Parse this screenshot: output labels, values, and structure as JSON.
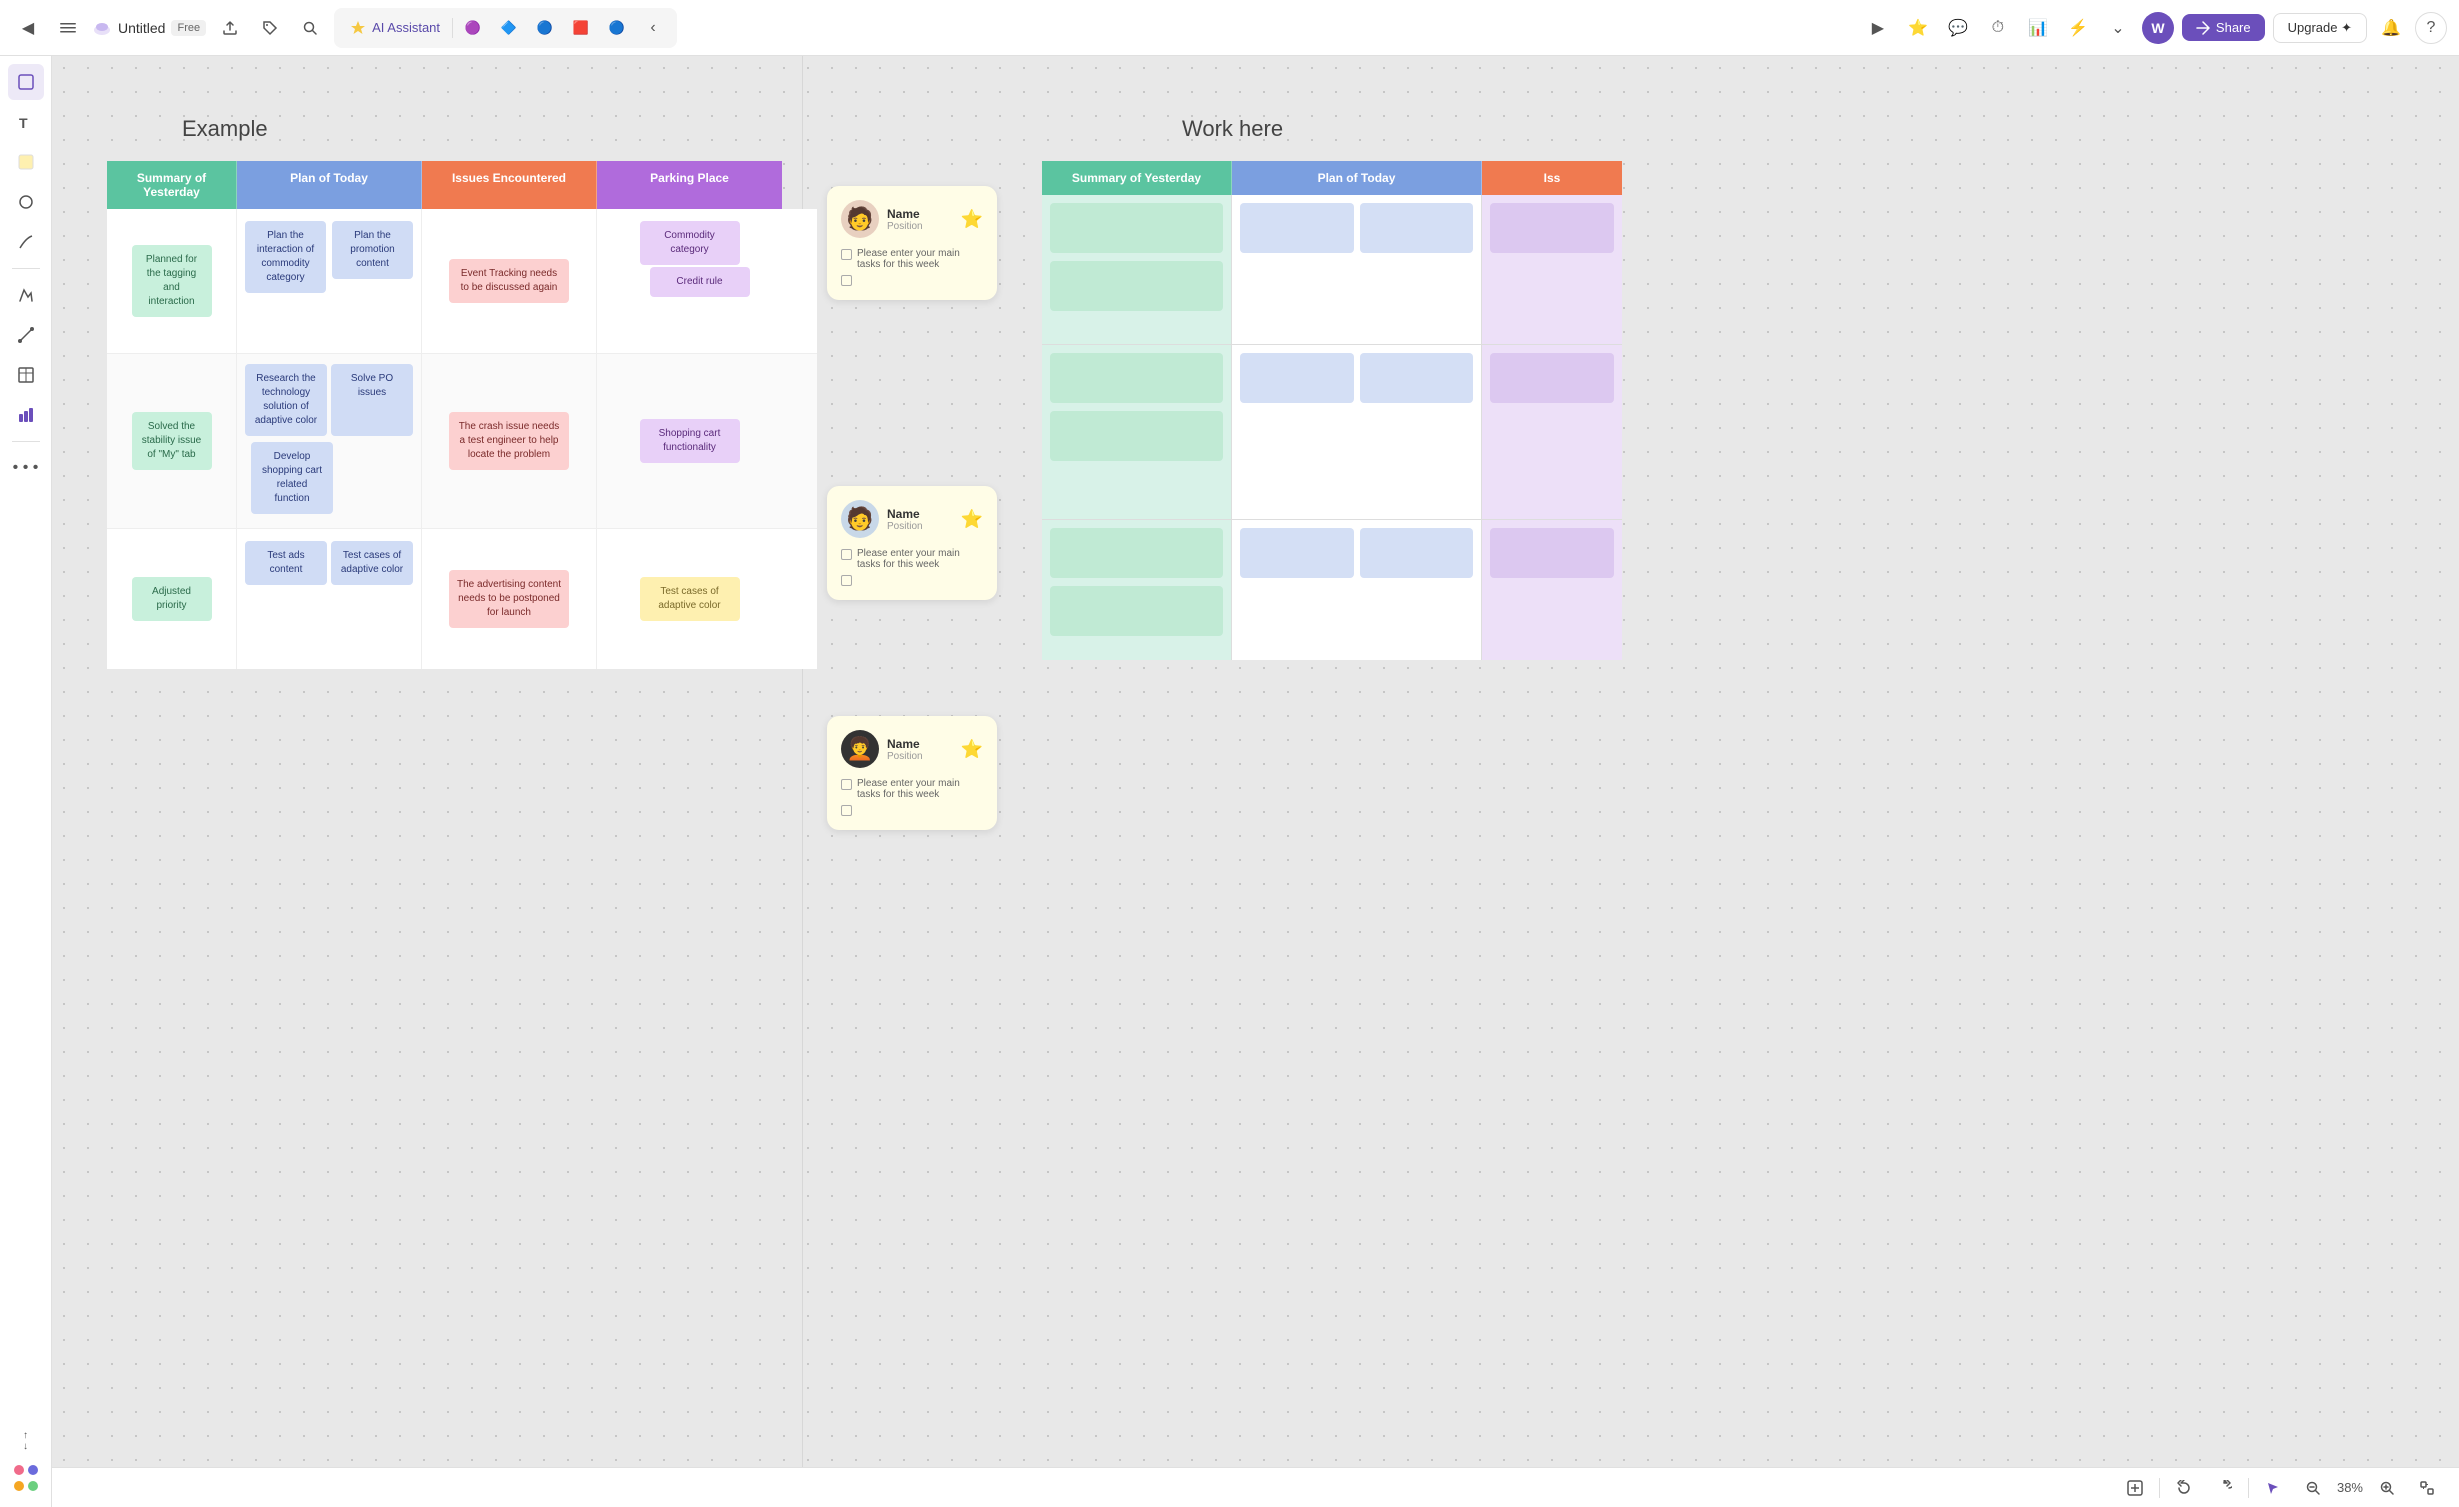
{
  "toolbar": {
    "back_icon": "◀",
    "menu_icon": "☰",
    "app_icon": "☁",
    "title": "Untitled",
    "free_label": "Free",
    "export_icon": "⬆",
    "tag_icon": "🏷",
    "search_icon": "🔍",
    "ai_label": "AI Assistant",
    "share_label": "Share",
    "upgrade_label": "Upgrade ✦",
    "avatar_initial": "W",
    "notification_icon": "🔔",
    "help_icon": "?"
  },
  "sidebar": {
    "icons": [
      "⊞",
      "T",
      "🗒",
      "◯",
      "∿",
      "✏",
      "✕",
      "…",
      "•"
    ]
  },
  "canvas": {
    "example_title": "Example",
    "work_title": "Work here"
  },
  "columns": [
    {
      "id": "yesterday",
      "label": "Summary of Yesterday",
      "color": "green"
    },
    {
      "id": "today",
      "label": "Plan of Today",
      "color": "blue"
    },
    {
      "id": "issues",
      "label": "Issues Encountered",
      "color": "orange"
    },
    {
      "id": "parking",
      "label": "Parking Place",
      "color": "purple"
    }
  ],
  "row1": {
    "yesterday": "Planned for the tagging and interaction",
    "today_1": "Plan the interaction of commodity category",
    "today_2": "Plan the promotion content",
    "issues": "Event Tracking needs to be discussed again",
    "parking_1": "Commodity category",
    "parking_2": "Credit rule"
  },
  "row2": {
    "yesterday": "Solved the stability issue of \"My\" tab",
    "today_1": "Research the technology solution of adaptive color",
    "today_2": "Solve PO issues",
    "today_3": "Develop shopping cart related function",
    "issues": "The crash issue needs a test engineer to help locate the problem",
    "parking": "Shopping cart functionality"
  },
  "row3": {
    "yesterday": "Adjusted priority",
    "today_1": "Test ads content",
    "today_2": "Test cases of adaptive color",
    "issues": "The advertising content needs to be postponed for launch",
    "parking": "Test cases of adaptive color"
  },
  "users": [
    {
      "name": "Name",
      "position": "Position",
      "task_placeholder": "Please enter your main tasks for this week"
    },
    {
      "name": "Name",
      "position": "Position",
      "task_placeholder": "Please enter your main tasks for this week"
    },
    {
      "name": "Name",
      "position": "Position",
      "task_placeholder": "Please enter your main tasks for this week"
    }
  ],
  "bottom": {
    "zoom_level": "38%"
  },
  "right_cols": [
    {
      "label": "Summary of Yesterday",
      "color": "green"
    },
    {
      "label": "Plan of Today",
      "color": "blue"
    },
    {
      "label": "Iss",
      "color": "orange"
    }
  ]
}
